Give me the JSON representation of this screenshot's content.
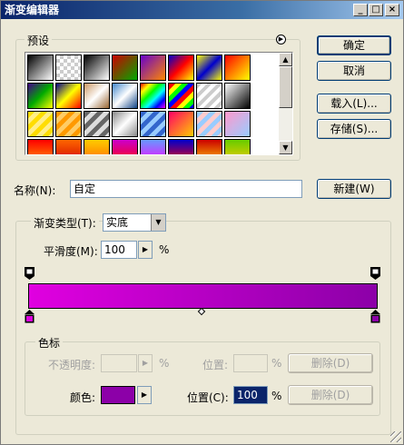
{
  "window": {
    "title": "渐变编辑器"
  },
  "buttons": {
    "ok": "确定",
    "cancel": "取消",
    "load": "载入(L)...",
    "save": "存储(S)...",
    "new": "新建(W)",
    "delete_opacity": "删除(D)",
    "delete_color": "删除(D)"
  },
  "presets": {
    "label": "预设",
    "menu_icon": "circle-arrow-icon"
  },
  "name": {
    "label": "名称(N):",
    "value": "自定"
  },
  "gradient_type": {
    "label": "渐变类型(T):",
    "selected": "实底",
    "smoothness_label": "平滑度(M):",
    "smoothness_value": "100",
    "smoothness_unit": "%"
  },
  "gradient": {
    "start_color": "#e000e0",
    "end_color": "#8c00a8",
    "midpoint_icon": "diamond-icon"
  },
  "stops": {
    "label": "色标",
    "opacity_label": "不透明度:",
    "opacity_value": "",
    "opacity_unit": "%",
    "opacity_location_label": "位置:",
    "opacity_location_value": "",
    "opacity_location_unit": "%",
    "color_label": "颜色:",
    "color_swatch": "#8c00a8",
    "color_location_label": "位置(C):",
    "color_location_value": "100",
    "color_location_unit": "%"
  }
}
